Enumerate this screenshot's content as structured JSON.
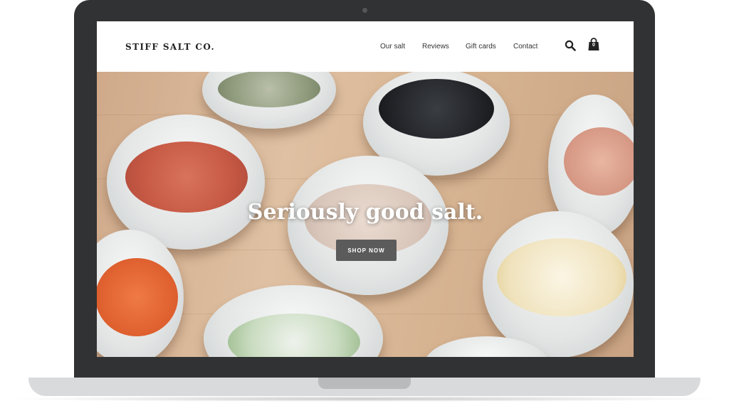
{
  "site": {
    "logo": "STIFF SALT CO."
  },
  "nav": {
    "items": [
      "Our salt",
      "Reviews",
      "Gift cards",
      "Contact"
    ]
  },
  "cart": {
    "count": "0"
  },
  "hero": {
    "title": "Seriously good salt.",
    "cta_label": "SHOP NOW"
  },
  "icons": {
    "search": "search-icon",
    "cart": "shopping-bag-icon"
  },
  "colors": {
    "header_bg": "#ffffff",
    "text": "#333333",
    "button_bg": "#5b5b5b",
    "button_text": "#ffffff",
    "laptop_frame": "#313233"
  }
}
